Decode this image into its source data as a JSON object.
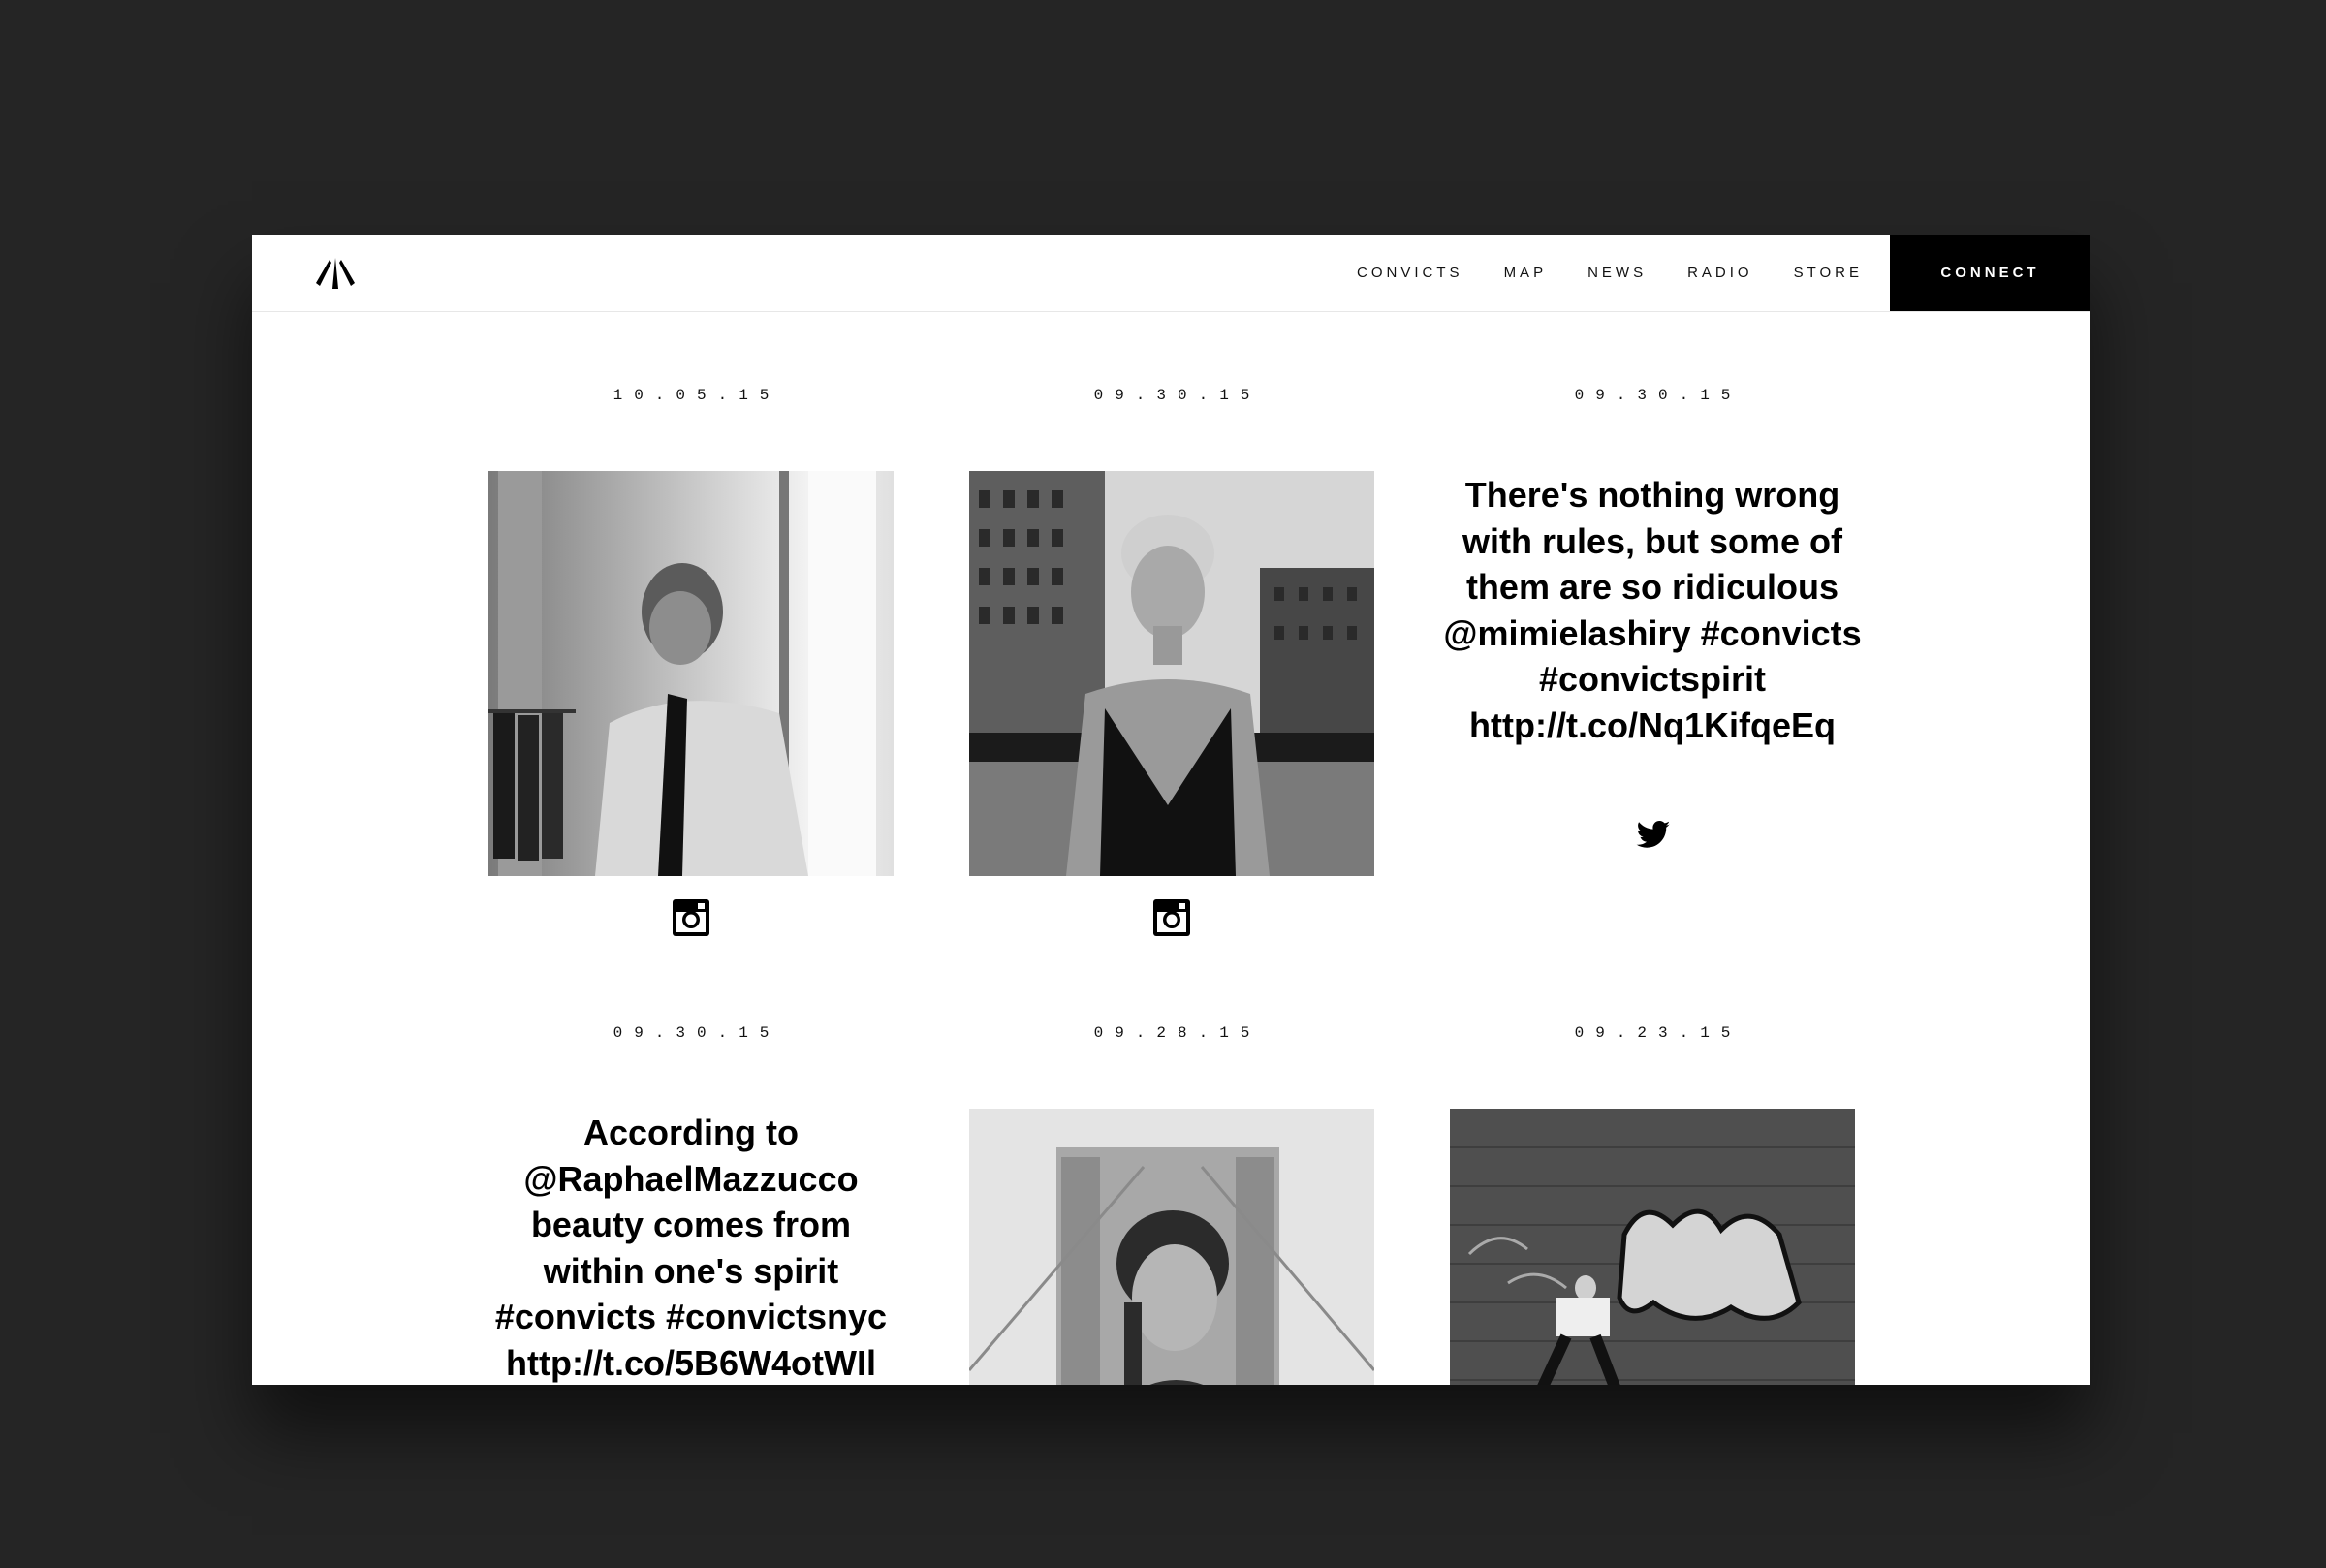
{
  "nav": {
    "items": [
      "CONVICTS",
      "MAP",
      "NEWS",
      "RADIO",
      "STORE"
    ],
    "connect_label": "CONNECT"
  },
  "posts": [
    {
      "date": "10.05.15",
      "type": "instagram",
      "icon": "instagram-icon"
    },
    {
      "date": "09.30.15",
      "type": "instagram",
      "icon": "instagram-icon"
    },
    {
      "date": "09.30.15",
      "type": "twitter",
      "icon": "twitter-icon",
      "text": "There's nothing wrong with rules, but some of them are so ridiculous @mimielashiry #convicts #convictspirit http://t.co/Nq1KifqeEq"
    },
    {
      "date": "09.30.15",
      "type": "twitter",
      "text": "According to @RaphaelMazzucco beauty comes from within one's spirit #convicts #convictsnyc http://t.co/5B6W4otWIl"
    },
    {
      "date": "09.28.15",
      "type": "instagram"
    },
    {
      "date": "09.23.15",
      "type": "instagram"
    }
  ],
  "colors": {
    "background": "#252525",
    "accent": "#000000",
    "page": "#ffffff"
  }
}
